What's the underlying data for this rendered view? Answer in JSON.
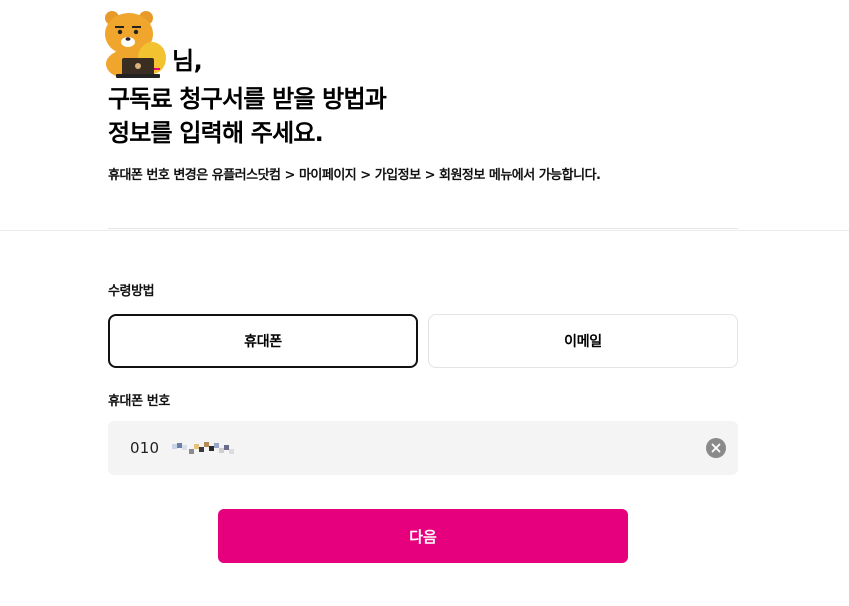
{
  "header": {
    "name_suffix": "님,",
    "title_line1": "구독료 청구서를 받을 방법과",
    "title_line2": "정보를 입력해 주세요.",
    "note": "휴대폰 번호 변경은 유플러스닷컴 > 마이페이지 > 가입정보 > 회원정보 메뉴에서 가능합니다."
  },
  "form": {
    "method_label": "수령방법",
    "methods": [
      {
        "label": "휴대폰",
        "selected": true
      },
      {
        "label": "이메일",
        "selected": false
      }
    ],
    "phone_label": "휴대폰 번호",
    "phone_value": "010"
  },
  "actions": {
    "next_label": "다음"
  },
  "icons": {
    "avatar": "ryan-character-avatar",
    "clear": "clear-x-icon"
  },
  "colors": {
    "primary": "#e6007e",
    "input_bg": "#f4f4f4",
    "selected_border": "#111111",
    "clear_icon": "#8a8a8a"
  }
}
